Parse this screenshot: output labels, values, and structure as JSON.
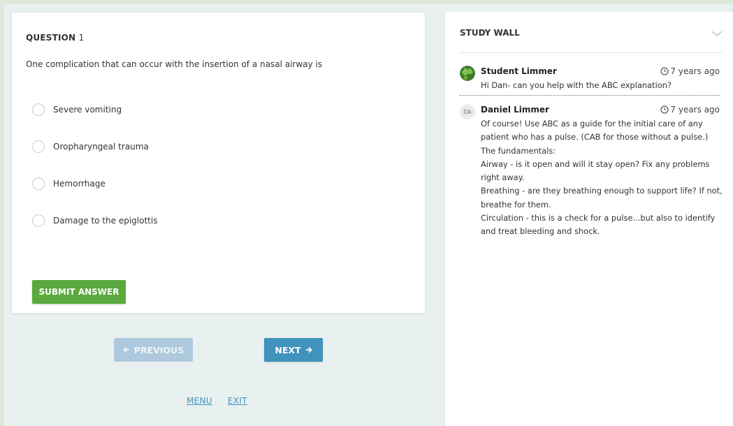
{
  "question": {
    "label": "QUESTION",
    "number": "1",
    "text": "One complication that can occur with the insertion of a nasal airway is",
    "options": [
      "Severe vomiting",
      "Oropharyngeal trauma",
      "Hemorrhage",
      "Damage to the epiglottis"
    ],
    "submit_label": "SUBMIT ANSWER"
  },
  "nav": {
    "previous_label": "PREVIOUS",
    "next_label": "NEXT",
    "menu_label": "MENU",
    "exit_label": "EXIT"
  },
  "study_wall": {
    "title": "STUDY WALL",
    "posts": [
      {
        "author": "Student Limmer",
        "time": "7 years ago",
        "lines": [
          "Hi Dan- can you help with the ABC explanation?"
        ]
      },
      {
        "author": "Daniel Limmer",
        "initials": "DA",
        "time": "7 years ago",
        "lines": [
          "Of course! Use ABC as a guide for the initial care of any",
          "patient who has a pulse. (CAB for those without a pulse.)",
          "The fundamentals:",
          "Airway - is it open and will it stay open? Fix any problems",
          "right away.",
          "Breathing - are they breathing enough to support life? If not,",
          "breathe for them.",
          "Circulation - this is a check for a pulse...but also to identify",
          "and treat bleeding and shock."
        ]
      }
    ]
  },
  "colors": {
    "submit": "#5aa93f",
    "next": "#3f93bd",
    "previous_disabled": "#aec9dd",
    "link": "#3f93bd",
    "background": "#e9f0f0"
  },
  "icons": {
    "previous": "arrow-left-icon",
    "next": "arrow-right-icon",
    "collapse": "chevron-down-icon",
    "time": "clock-icon",
    "student_avatar": "globe-avatar-icon"
  }
}
